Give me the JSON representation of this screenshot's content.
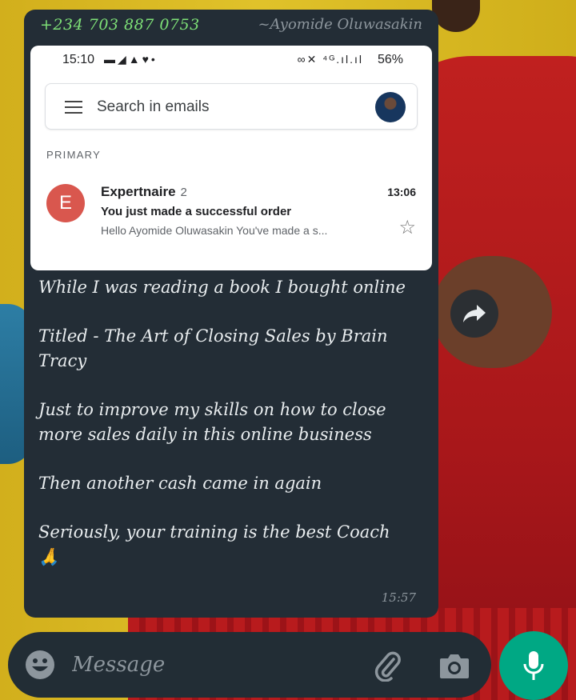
{
  "message": {
    "sender_phone": "+234 703 887 0753",
    "sender_name": "~Ayomide Oluwasakin",
    "time": "15:57",
    "paragraphs": [
      "While I was reading a book I bought online",
      "Titled - The Art of Closing Sales by Brain Tracy",
      "Just to improve my skills on how to close more sales daily in this online business",
      "Then another cash came in again",
      "Seriously, your training is the best Coach"
    ],
    "emoji": "🙏"
  },
  "screenshot": {
    "status_time": "15:10",
    "battery": "56%",
    "search_placeholder": "Search in emails",
    "section_label": "PRIMARY",
    "email": {
      "avatar_letter": "E",
      "avatar_color": "#d9574e",
      "sender": "Expertnaire",
      "count": "2",
      "time": "13:06",
      "subject": "You just made a successful order",
      "snippet": "Hello Ayomide Oluwasakin You've made a s..."
    }
  },
  "input_bar": {
    "placeholder": "Message"
  },
  "colors": {
    "bubble": "#232d36",
    "accent_green": "#00a884",
    "phone_green": "#7ee077"
  }
}
